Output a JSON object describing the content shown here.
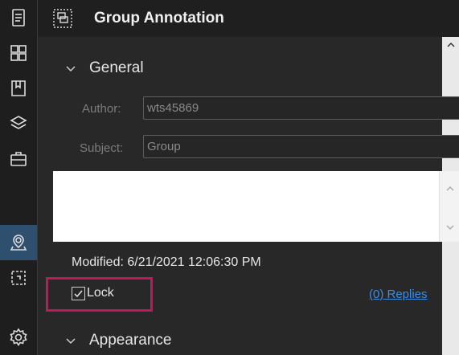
{
  "sidebar": {
    "items": [
      {
        "icon": "document-icon"
      },
      {
        "icon": "grid-icon"
      },
      {
        "icon": "bookmark-icon"
      },
      {
        "icon": "layers-icon"
      },
      {
        "icon": "briefcase-icon"
      },
      {
        "icon": "location-icon",
        "active": true
      },
      {
        "icon": "select-icon"
      },
      {
        "icon": "settings-icon"
      }
    ]
  },
  "header": {
    "title": "Group Annotation",
    "icon": "group-annotation-icon"
  },
  "general": {
    "section_label": "General",
    "author_label": "Author:",
    "author_value": "wts45869",
    "subject_label": "Subject:",
    "subject_value": "Group",
    "note_value": "",
    "modified_text": "Modified: 6/21/2021 12:06:30 PM",
    "lock_label": "Lock",
    "lock_checked": true,
    "replies_text": "(0) Replies"
  },
  "appearance": {
    "section_label": "Appearance"
  },
  "colors": {
    "highlight": "#c2185b",
    "active_sidebar": "#2f4f6e",
    "link": "#3a8ee6"
  }
}
